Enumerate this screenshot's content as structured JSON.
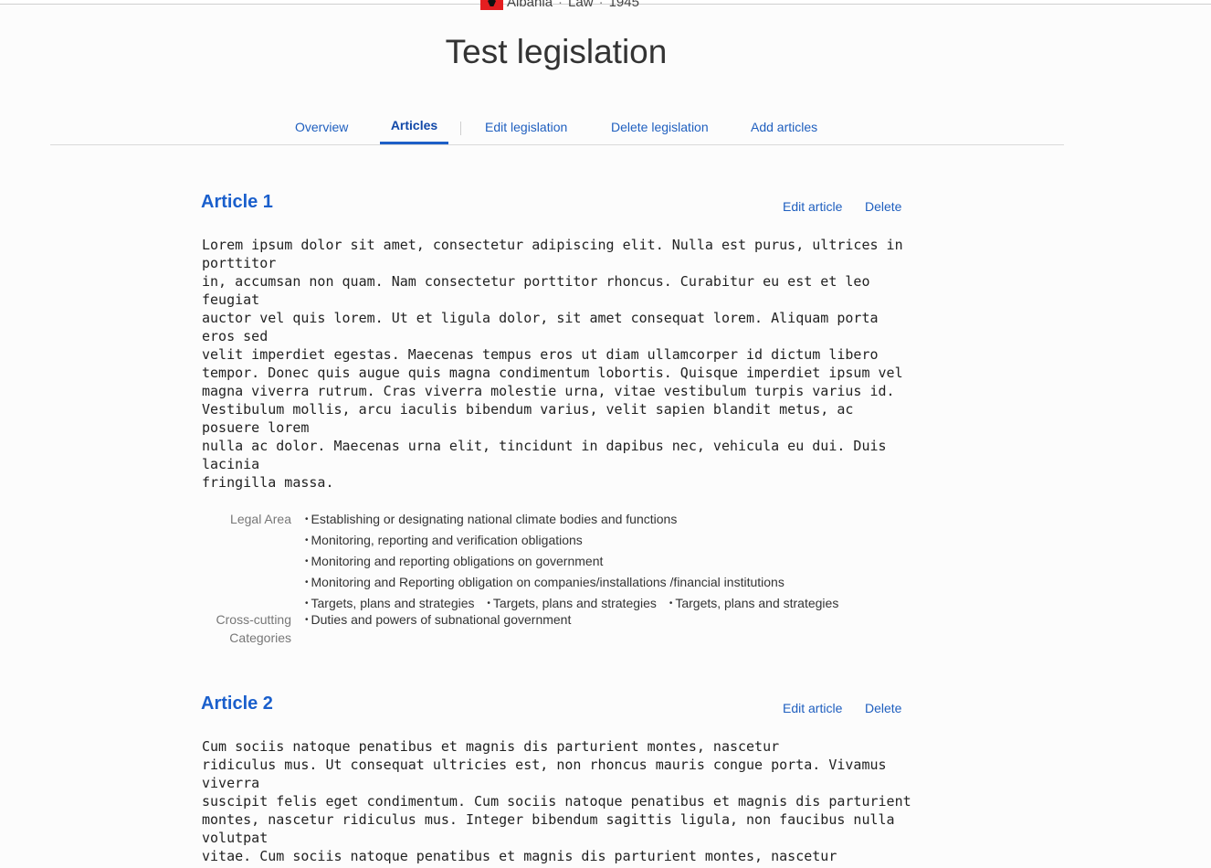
{
  "header": {
    "country": "Albania",
    "separator": "·",
    "doc_type": "Law",
    "year": "1945",
    "title": "Test legislation"
  },
  "tabs": {
    "overview": "Overview",
    "articles": "Articles",
    "edit": "Edit legislation",
    "delete": "Delete legislation",
    "add": "Add articles"
  },
  "articles": [
    {
      "title": "Article 1",
      "edit_label": "Edit article",
      "delete_label": "Delete",
      "body": "Lorem ipsum dolor sit amet, consectetur adipiscing elit. Nulla est purus, ultrices in\nporttitor\nin, accumsan non quam. Nam consectetur porttitor rhoncus. Curabitur eu est et leo\nfeugiat\nauctor vel quis lorem. Ut et ligula dolor, sit amet consequat lorem. Aliquam porta\neros sed\nvelit imperdiet egestas. Maecenas tempus eros ut diam ullamcorper id dictum libero\ntempor. Donec quis augue quis magna condimentum lobortis. Quisque imperdiet ipsum vel\nmagna viverra rutrum. Cras viverra molestie urna, vitae vestibulum turpis varius id.\nVestibulum mollis, arcu iaculis bibendum varius, velit sapien blandit metus, ac\nposuere lorem\nnulla ac dolor. Maecenas urna elit, tincidunt in dapibus nec, vehicula eu dui. Duis\nlacinia\nfringilla massa.",
      "legal_area_label": "Legal Area",
      "legal_areas": [
        "Establishing or designating national climate bodies and functions",
        "Monitoring, reporting and verification obligations",
        "Monitoring and reporting obligations on government",
        "Monitoring and Reporting obligation on companies/installations /financial institutions",
        "Targets, plans and strategies",
        "Targets, plans and strategies",
        "Targets, plans and strategies"
      ],
      "cross_label_1": "Cross-cutting",
      "cross_label_2": "Categories",
      "cross_cutting": [
        "Duties and powers of subnational government"
      ]
    },
    {
      "title": "Article 2",
      "edit_label": "Edit article",
      "delete_label": "Delete",
      "body": "Cum sociis natoque penatibus et magnis dis parturient montes, nascetur\nridiculus mus. Ut consequat ultricies est, non rhoncus mauris congue porta. Vivamus\nviverra\nsuscipit felis eget condimentum. Cum sociis natoque penatibus et magnis dis parturient\nmontes, nascetur ridiculus mus. Integer bibendum sagittis ligula, non faucibus nulla\nvolutpat\nvitae. Cum sociis natoque penatibus et magnis dis parturient montes, nascetur"
    }
  ]
}
